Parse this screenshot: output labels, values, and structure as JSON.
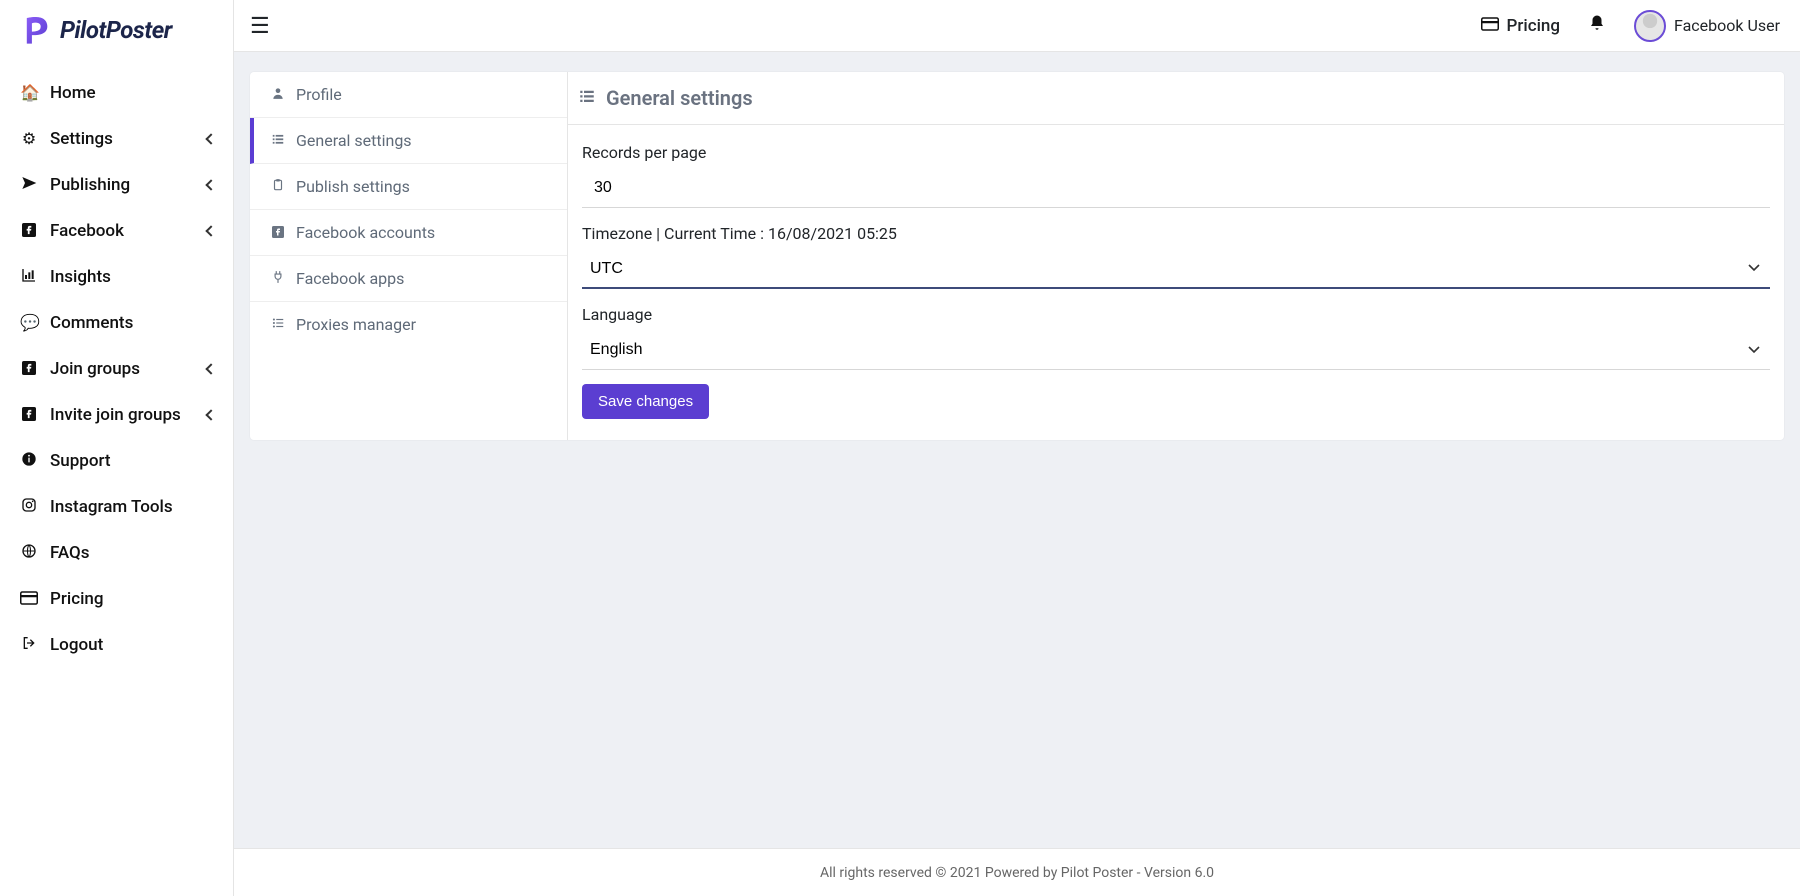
{
  "brand": {
    "name": "PilotPoster"
  },
  "sidebar": {
    "items": [
      {
        "label": "Home",
        "icon": "home",
        "expandable": false
      },
      {
        "label": "Settings",
        "icon": "gear",
        "expandable": true
      },
      {
        "label": "Publishing",
        "icon": "paper-plane",
        "expandable": true
      },
      {
        "label": "Facebook",
        "icon": "facebook",
        "expandable": true
      },
      {
        "label": "Insights",
        "icon": "chart",
        "expandable": false
      },
      {
        "label": "Comments",
        "icon": "comment",
        "expandable": false
      },
      {
        "label": "Join groups",
        "icon": "facebook",
        "expandable": true
      },
      {
        "label": "Invite join groups",
        "icon": "facebook",
        "expandable": true
      },
      {
        "label": "Support",
        "icon": "info",
        "expandable": false
      },
      {
        "label": "Instagram Tools",
        "icon": "instagram",
        "expandable": false
      },
      {
        "label": "FAQs",
        "icon": "globe",
        "expandable": false
      },
      {
        "label": "Pricing",
        "icon": "card",
        "expandable": false
      },
      {
        "label": "Logout",
        "icon": "logout",
        "expandable": false
      }
    ]
  },
  "topbar": {
    "pricing_label": "Pricing",
    "user_name": "Facebook User"
  },
  "settings_tabs": {
    "items": [
      {
        "label": "Profile",
        "icon": "user"
      },
      {
        "label": "General settings",
        "icon": "list",
        "active": true
      },
      {
        "label": "Publish settings",
        "icon": "clipboard"
      },
      {
        "label": "Facebook accounts",
        "icon": "facebook"
      },
      {
        "label": "Facebook apps",
        "icon": "plug"
      },
      {
        "label": "Proxies manager",
        "icon": "list"
      }
    ]
  },
  "form": {
    "title": "General settings",
    "records_label": "Records per page",
    "records_value": "30",
    "timezone_label": "Timezone | Current Time : 16/08/2021 05:25",
    "timezone_value": "UTC",
    "language_label": "Language",
    "language_value": "English",
    "save_label": "Save changes"
  },
  "footer": {
    "text": "All rights reserved © 2021 Powered by Pilot Poster - Version 6.0"
  },
  "colors": {
    "accent": "#5b3ed1"
  }
}
